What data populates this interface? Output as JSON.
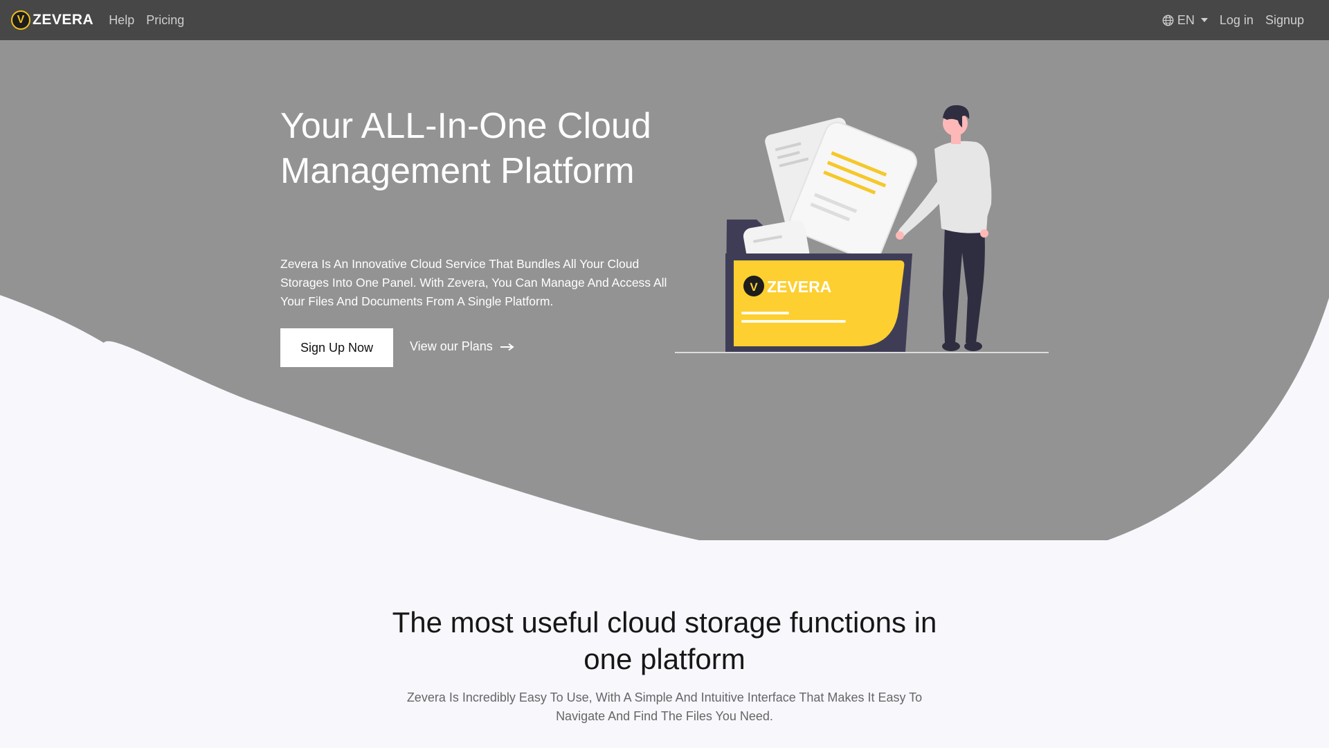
{
  "nav": {
    "brand": "ZEVERA",
    "brand_badge": "V",
    "links": [
      "Help",
      "Pricing"
    ],
    "language": "EN",
    "login": "Log in",
    "signup": "Signup"
  },
  "hero": {
    "title": "Your ALL-In-One Cloud Management Platform",
    "description": "Zevera Is An Innovative Cloud Service That Bundles All Your Cloud Storages Into One Panel. With Zevera, You Can Manage And Access All Your Files And Documents From A Single Platform.",
    "cta_primary": "Sign Up Now",
    "cta_secondary": "View our Plans",
    "illustration_brand": "ZEVERA",
    "illustration_badge": "V"
  },
  "features": {
    "title": "The most useful cloud storage functions in one platform",
    "description": "Zevera Is Incredibly Easy To Use, With A Simple And Intuitive Interface That Makes It Easy To Navigate And Find The Files You Need."
  },
  "colors": {
    "navbar_bg": "#474747",
    "hero_bg": "#939393",
    "page_bg": "#f7f7fc",
    "accent_yellow": "#fdcf30",
    "folder_dark": "#3f3d56"
  },
  "icons": {
    "language": "globe-icon",
    "language_toggle": "chevron-down-icon",
    "plans_arrow": "arrow-right-icon"
  }
}
